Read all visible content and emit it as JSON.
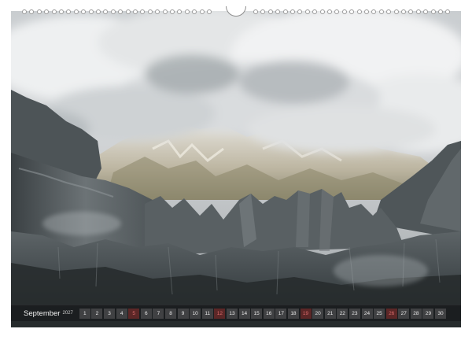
{
  "calendar": {
    "month": "September",
    "year": "2027",
    "days": [
      {
        "n": "1",
        "sunday": false
      },
      {
        "n": "2",
        "sunday": false
      },
      {
        "n": "3",
        "sunday": false
      },
      {
        "n": "4",
        "sunday": false
      },
      {
        "n": "5",
        "sunday": true
      },
      {
        "n": "6",
        "sunday": false
      },
      {
        "n": "7",
        "sunday": false
      },
      {
        "n": "8",
        "sunday": false
      },
      {
        "n": "9",
        "sunday": false
      },
      {
        "n": "10",
        "sunday": false
      },
      {
        "n": "11",
        "sunday": false
      },
      {
        "n": "12",
        "sunday": true
      },
      {
        "n": "13",
        "sunday": false
      },
      {
        "n": "14",
        "sunday": false
      },
      {
        "n": "15",
        "sunday": false
      },
      {
        "n": "16",
        "sunday": false
      },
      {
        "n": "17",
        "sunday": false
      },
      {
        "n": "18",
        "sunday": false
      },
      {
        "n": "19",
        "sunday": true
      },
      {
        "n": "20",
        "sunday": false
      },
      {
        "n": "21",
        "sunday": false
      },
      {
        "n": "22",
        "sunday": false
      },
      {
        "n": "23",
        "sunday": false
      },
      {
        "n": "24",
        "sunday": false
      },
      {
        "n": "25",
        "sunday": false
      },
      {
        "n": "26",
        "sunday": true
      },
      {
        "n": "27",
        "sunday": false
      },
      {
        "n": "28",
        "sunday": false
      },
      {
        "n": "29",
        "sunday": false
      },
      {
        "n": "30",
        "sunday": false
      }
    ]
  },
  "colors": {
    "sunday": "#d86b6b",
    "weekday": "#e8e8e8"
  }
}
